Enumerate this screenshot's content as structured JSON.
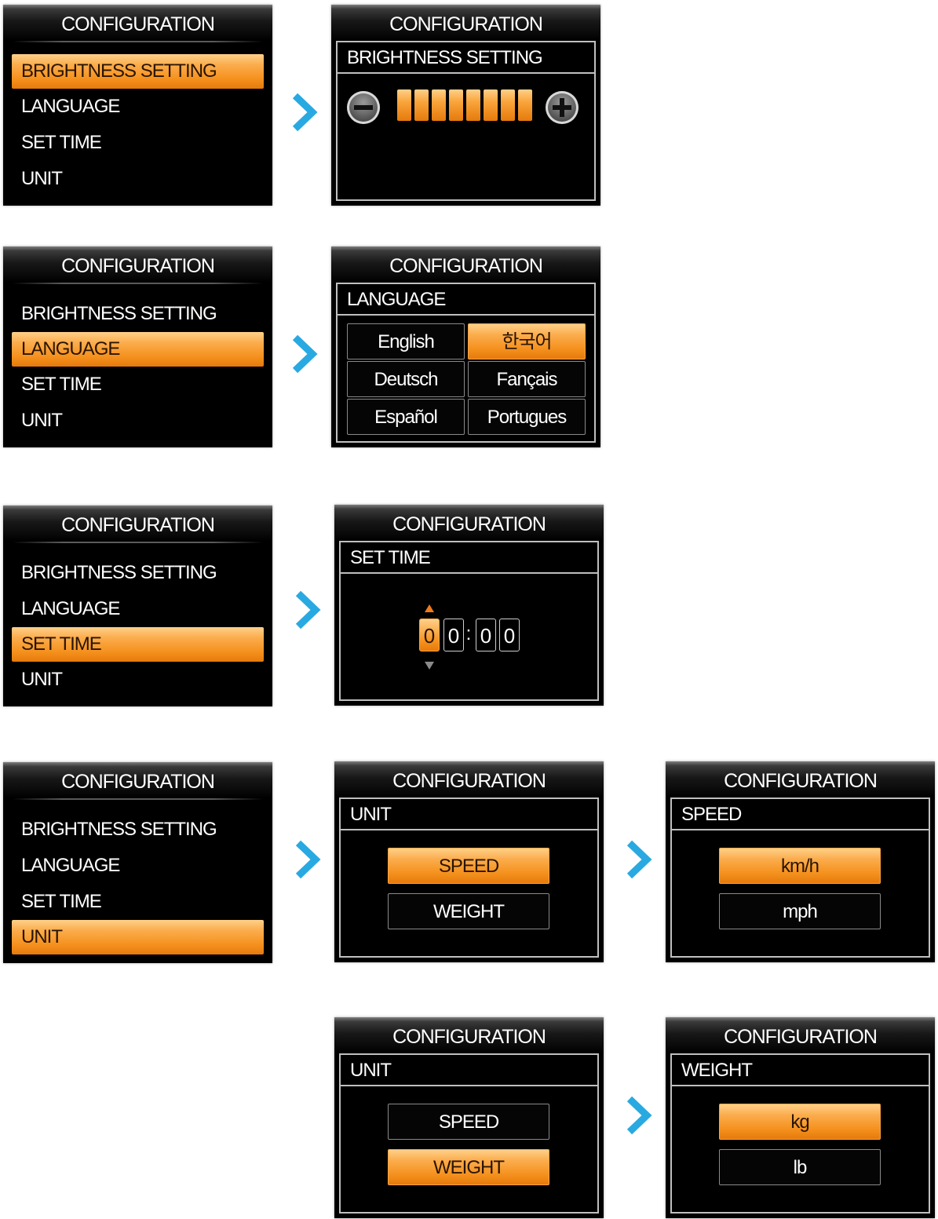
{
  "header_title": "CONFIGURATION",
  "menu_items": [
    "BRIGHTNESS SETTING",
    "LANGUAGE",
    "SET TIME",
    "UNIT"
  ],
  "brightness": {
    "title": "BRIGHTNESS SETTING",
    "minus_icon": "minus-circle-icon",
    "plus_icon": "plus-circle-icon",
    "level_segments": 8
  },
  "language": {
    "title": "LANGUAGE",
    "options": [
      "English",
      "한국어",
      "Deutsch",
      "Fançais",
      "Español",
      "Portugues"
    ],
    "selected": "한국어"
  },
  "set_time": {
    "title": "SET TIME",
    "digits": [
      "0",
      "0",
      "0",
      "0"
    ],
    "separator": ":",
    "up_icon": "triangle-up-icon",
    "down_icon": "triangle-down-icon"
  },
  "unit": {
    "title": "UNIT",
    "options": [
      "SPEED",
      "WEIGHT"
    ]
  },
  "speed": {
    "title": "SPEED",
    "options": [
      "km/h",
      "mph"
    ],
    "selected": "km/h"
  },
  "weight": {
    "title": "WEIGHT",
    "options": [
      "kg",
      "lb"
    ],
    "selected": "kg"
  },
  "colors": {
    "accent": "#f5921f",
    "screen_bg": "#000000",
    "arrow": "#29a9e1"
  }
}
